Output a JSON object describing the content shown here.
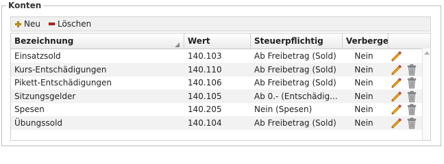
{
  "panel": {
    "title": "Konten"
  },
  "toolbar": {
    "new_label": "Neu",
    "delete_label": "Löschen"
  },
  "table": {
    "columns": [
      "Bezeichnung",
      "Wert",
      "Steuerpflichtig",
      "Verbergen"
    ],
    "rows": [
      {
        "bezeichnung": "Einsatzsold",
        "wert": "140.103",
        "steuer": "Ab Freibetrag (Sold)",
        "verbergen": "Nein",
        "deletable": false
      },
      {
        "bezeichnung": "Kurs-Entschädigungen",
        "wert": "140.110",
        "steuer": "Ab Freibetrag (Sold)",
        "verbergen": "Nein",
        "deletable": true
      },
      {
        "bezeichnung": "Pikett-Entschädigungen",
        "wert": "140.106",
        "steuer": "Ab Freibetrag (Sold)",
        "verbergen": "Nein",
        "deletable": true
      },
      {
        "bezeichnung": "Sitzungsgelder",
        "wert": "140.105",
        "steuer": "Ab 0.- (Entschädig...",
        "verbergen": "Nein",
        "deletable": true
      },
      {
        "bezeichnung": "Spesen",
        "wert": "140.205",
        "steuer": "Nein (Spesen)",
        "verbergen": "Nein",
        "deletable": true
      },
      {
        "bezeichnung": "Übungssold",
        "wert": "140.104",
        "steuer": "Ab Freibetrag (Sold)",
        "verbergen": "Nein",
        "deletable": true
      }
    ]
  },
  "colors": {
    "pencil": "#f0a020",
    "trash": "#8a8a8a",
    "row_alt": "#f2f2f2"
  },
  "icons": {
    "edit": "pencil-icon",
    "delete": "trash-icon",
    "new": "plus-icon",
    "remove": "minus-icon"
  }
}
